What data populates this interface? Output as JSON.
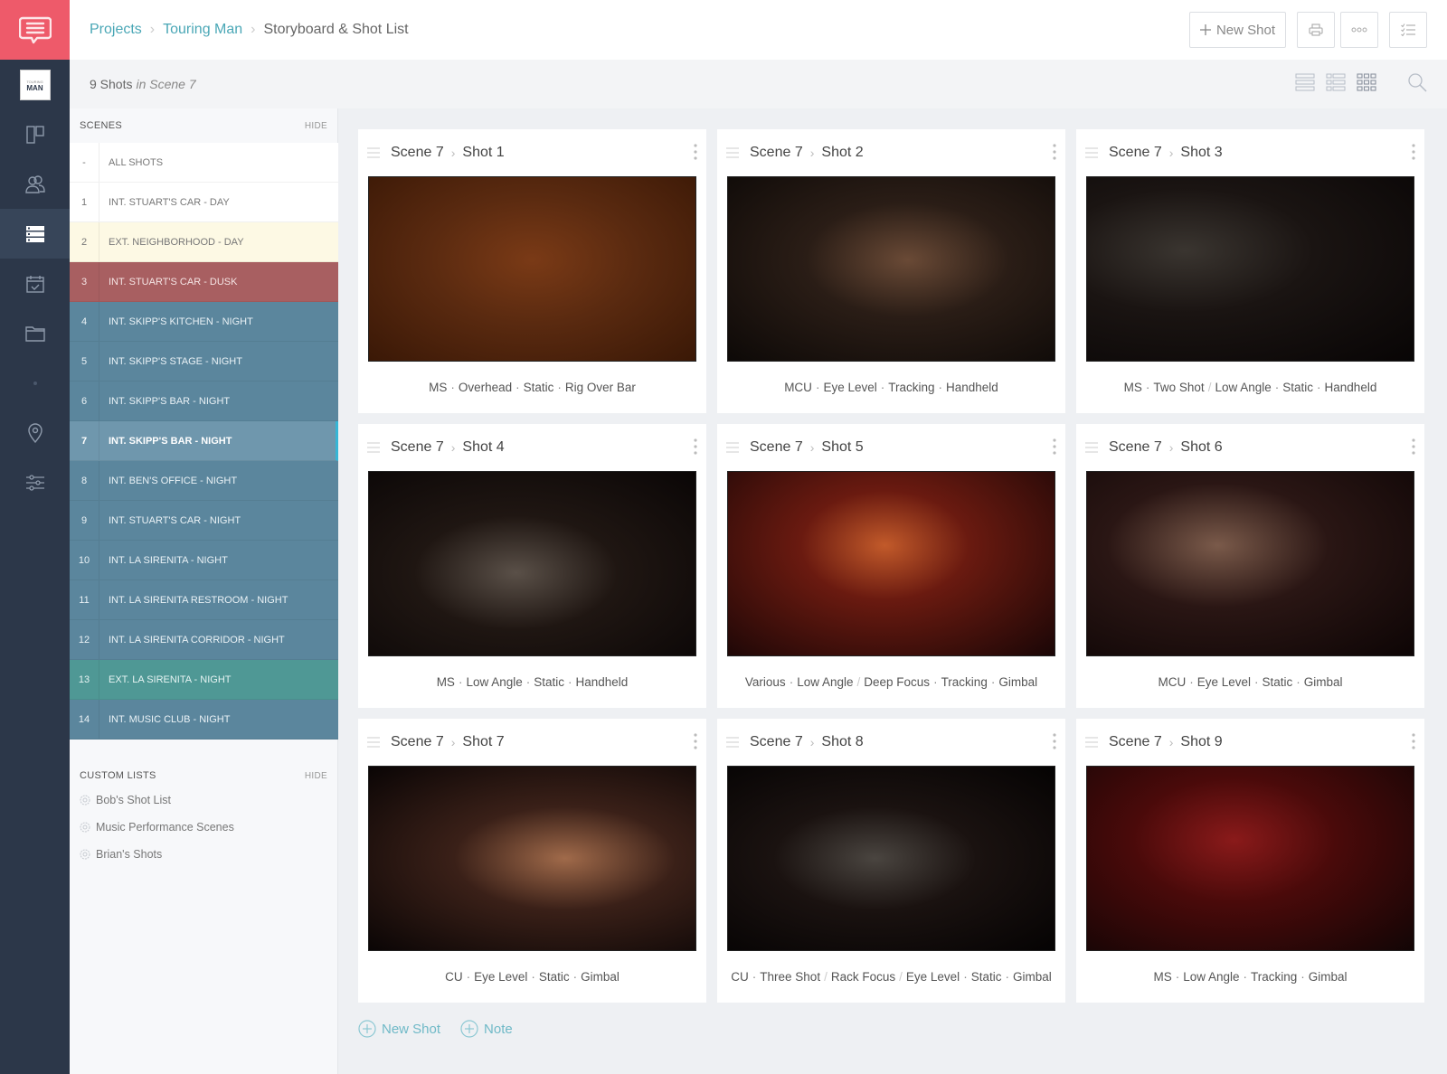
{
  "header": {
    "breadcrumbs": [
      {
        "label": "Projects",
        "link": true
      },
      {
        "label": "Touring Man",
        "link": true
      },
      {
        "label": "Storyboard & Shot List",
        "link": false
      }
    ],
    "new_shot_label": "New Shot",
    "actions": [
      "print-icon",
      "more-icon",
      "checklist-icon"
    ]
  },
  "project_thumb": {
    "line1": "TOURING",
    "line2": "MAN"
  },
  "rail": {
    "items": [
      {
        "icon": "storyboard-icon"
      },
      {
        "icon": "people-icon"
      },
      {
        "icon": "shot-list-icon",
        "active": true
      },
      {
        "icon": "calendar-icon"
      },
      {
        "icon": "folder-icon"
      },
      {
        "icon": "dot"
      },
      {
        "icon": "location-icon"
      },
      {
        "icon": "settings-sliders-icon"
      }
    ]
  },
  "subheader": {
    "count_text": "9 Shots",
    "scope_text": "in Scene 7",
    "views": [
      "list-view-icon",
      "detail-list-view-icon",
      "grid-view-icon"
    ],
    "search_icon": "search-icon"
  },
  "scenes": {
    "title": "SCENES",
    "hide_label": "HIDE",
    "items": [
      {
        "num": "-",
        "label": "ALL SHOTS",
        "style": "white"
      },
      {
        "num": "1",
        "label": "INT. STUART'S CAR - DAY",
        "style": "white"
      },
      {
        "num": "2",
        "label": "EXT. NEIGHBORHOOD - DAY",
        "style": "yellow"
      },
      {
        "num": "3",
        "label": "INT. STUART'S CAR - DUSK",
        "style": "red"
      },
      {
        "num": "4",
        "label": "INT. SKIPP'S KITCHEN - NIGHT",
        "style": "blue"
      },
      {
        "num": "5",
        "label": "INT. SKIPP'S STAGE - NIGHT",
        "style": "blue"
      },
      {
        "num": "6",
        "label": "INT. SKIPP'S BAR - NIGHT",
        "style": "blue"
      },
      {
        "num": "7",
        "label": "INT. SKIPP'S BAR - NIGHT",
        "style": "active"
      },
      {
        "num": "8",
        "label": "INT. BEN'S OFFICE - NIGHT",
        "style": "blue"
      },
      {
        "num": "9",
        "label": "INT. STUART'S CAR - NIGHT",
        "style": "blue"
      },
      {
        "num": "10",
        "label": "INT. LA SIRENITA - NIGHT",
        "style": "blue"
      },
      {
        "num": "11",
        "label": "INT. LA SIRENITA RESTROOM - NIGHT",
        "style": "blue"
      },
      {
        "num": "12",
        "label": "INT. LA SIRENITA CORRIDOR - NIGHT",
        "style": "blue"
      },
      {
        "num": "13",
        "label": "EXT. LA SIRENITA - NIGHT",
        "style": "teal"
      },
      {
        "num": "14",
        "label": "INT. MUSIC CLUB - NIGHT",
        "style": "blue"
      }
    ]
  },
  "custom_lists": {
    "title": "CUSTOM LISTS",
    "hide_label": "HIDE",
    "items": [
      "Bob's Shot List",
      "Music Performance Scenes",
      "Brian's Shots"
    ]
  },
  "shots": [
    {
      "scene": "Scene 7",
      "shot": "Shot 1",
      "caption": [
        [
          "MS",
          "Overhead",
          "Static",
          "Rig Over Bar"
        ]
      ],
      "thumb": "overhead bar glass"
    },
    {
      "scene": "Scene 7",
      "shot": "Shot 2",
      "caption": [
        [
          "MCU",
          "Eye Level",
          "Tracking",
          "Handheld"
        ]
      ],
      "thumb": "man close-up bar"
    },
    {
      "scene": "Scene 7",
      "shot": "Shot 3",
      "caption": [
        [
          "MS",
          "Two Shot"
        ],
        [
          "Low Angle",
          "Static",
          "Handheld"
        ]
      ],
      "thumb": "two shot red light"
    },
    {
      "scene": "Scene 7",
      "shot": "Shot 4",
      "caption": [
        [
          "MS",
          "Low Angle",
          "Static",
          "Handheld"
        ]
      ],
      "thumb": "DJ at keyboard"
    },
    {
      "scene": "Scene 7",
      "shot": "Shot 5",
      "caption": [
        [
          "Various",
          "Low Angle"
        ],
        [
          "Deep Focus",
          "Tracking",
          "Gimbal"
        ]
      ],
      "thumb": "guitarist on stage"
    },
    {
      "scene": "Scene 7",
      "shot": "Shot 6",
      "caption": [
        [
          "MCU",
          "Eye Level",
          "Static",
          "Gimbal"
        ]
      ],
      "thumb": "woman in beanie"
    },
    {
      "scene": "Scene 7",
      "shot": "Shot 7",
      "caption": [
        [
          "CU",
          "Eye Level",
          "Static",
          "Gimbal"
        ]
      ],
      "thumb": "singer at microphone"
    },
    {
      "scene": "Scene 7",
      "shot": "Shot 8",
      "caption": [
        [
          "CU",
          "Three Shot"
        ],
        [
          "Rack Focus"
        ],
        [
          "Eye Level",
          "Static",
          "Gimbal"
        ]
      ],
      "thumb": "three shot DJ"
    },
    {
      "scene": "Scene 7",
      "shot": "Shot 9",
      "caption": [
        [
          "MS",
          "Low Angle",
          "Tracking",
          "Gimbal"
        ]
      ],
      "thumb": "singer red curtain"
    }
  ],
  "bottom_actions": {
    "new_shot_label": "New Shot",
    "note_label": "Note"
  },
  "colors": {
    "brand": "#ee5a6a",
    "rail": "#2c3749",
    "link": "#4aa7b6",
    "scene_red": "#a85f61",
    "scene_blue": "#5b869d",
    "scene_active": "#6f97ad",
    "scene_teal": "#4f9895",
    "scene_yellow": "#fdf9e4",
    "active_indicator": "#36b6d6"
  }
}
